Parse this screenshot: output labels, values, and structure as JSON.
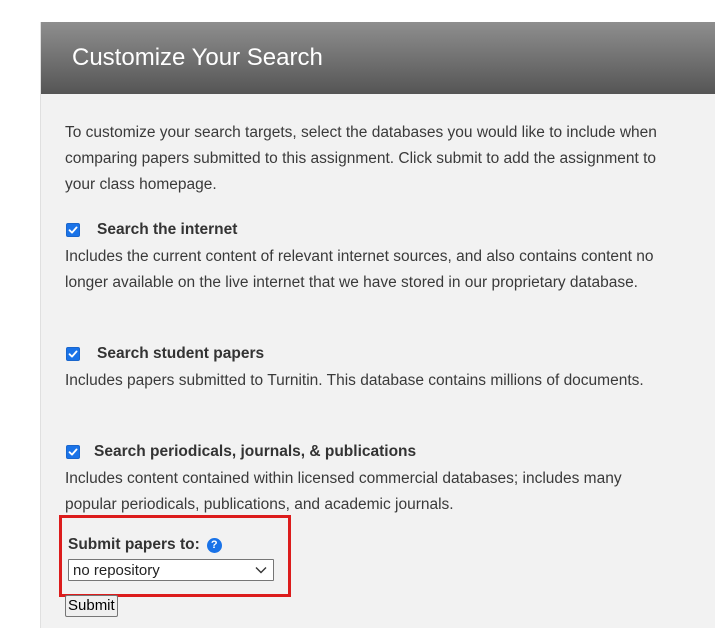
{
  "panel": {
    "title": "Customize Your Search",
    "intro": "To customize your search targets, select the databases you would like to include when comparing papers submitted to this assignment. Click submit to add the assignment to your class homepage."
  },
  "options": [
    {
      "label": "Search the internet",
      "checked": true,
      "description": "Includes the current content of relevant internet sources, and also contains content no longer available on the live internet that we have stored in our proprietary database."
    },
    {
      "label": "Search student papers",
      "checked": true,
      "description": "Includes papers submitted to Turnitin. This database contains millions of documents."
    },
    {
      "label": "Search periodicals, journals, & publications",
      "checked": true,
      "description": "Includes content contained within licensed commercial databases; includes many popular periodicals, publications, and academic journals."
    }
  ],
  "repository": {
    "label": "Submit papers to:",
    "help_icon": "?",
    "selected": "no repository"
  },
  "submit_label": "Submit",
  "colors": {
    "accent": "#1a73e8",
    "highlight_border": "#dc1c1c",
    "header_top": "#8e8e8e",
    "header_bottom": "#555555",
    "panel_bg": "#f2f2f2"
  }
}
